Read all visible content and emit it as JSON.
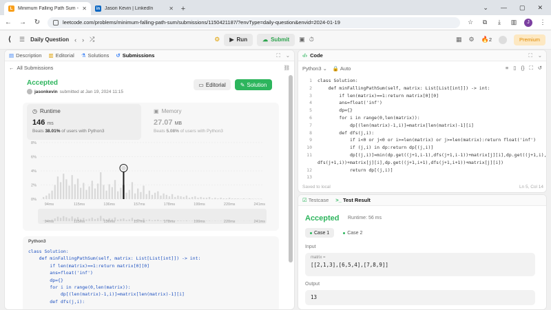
{
  "browser": {
    "tabs": [
      {
        "title": "Minimum Falling Path Sum - Le",
        "favicon": "leetcode-icon",
        "color": "#f89f1b"
      },
      {
        "title": "Jason Kevin | LinkedIn",
        "favicon": "linkedin-icon",
        "color": "#0a66c2"
      }
    ],
    "url": "leetcode.com/problems/minimum-falling-path-sum/submissions/1150421187/?envType=daily-question&envid=2024-01-19",
    "avatar_letter": "J"
  },
  "lcnav": {
    "daily": "Daily Question",
    "run": "Run",
    "submit": "Submit",
    "streak": "2",
    "premium": "Premium"
  },
  "left": {
    "tabs": [
      "Description",
      "Editorial",
      "Solutions",
      "Submissions"
    ],
    "back_link": "All Submissions",
    "status": "Accepted",
    "user": "jasonkevin",
    "submitted": "submitted at Jan 19, 2024 11:15",
    "editorial_btn": "Editorial",
    "solution_btn": "Solution",
    "runtime": {
      "label": "Runtime",
      "value": "146",
      "unit": "ms",
      "beats_prefix": "Beats",
      "beats": "38.01%",
      "beats_suffix": "of users with Python3"
    },
    "memory": {
      "label": "Memory",
      "value": "27.07",
      "unit": "MB",
      "beats_prefix": "Beats",
      "beats": "5.08%",
      "beats_suffix": "of users with Python3"
    },
    "code_lang": "Python3",
    "code_lines": [
      "class Solution:",
      "    def minFallingPathSum(self, matrix: List[List[int]]) -> int:",
      "        if len(matrix)==1:return matrix[0][0]",
      "        ans=float('inf')",
      "        dp={}",
      "        for i in range(0,len(matrix)):",
      "            dp[(len(matrix)-1,i)]=matrix[len(matrix)-1][i]",
      "        def dfs(j,i):"
    ]
  },
  "chart_data": {
    "type": "bar",
    "title": "",
    "xlabel": "",
    "ylabel": "",
    "yticks": [
      "8%",
      "6%",
      "4%",
      "2%",
      "0%"
    ],
    "ylim": [
      0,
      8
    ],
    "xticks": [
      "94ms",
      "115ms",
      "136ms",
      "157ms",
      "178ms",
      "199ms",
      "220ms",
      "241ms"
    ],
    "x": [
      90,
      92,
      94,
      96,
      98,
      100,
      102,
      104,
      106,
      108,
      110,
      112,
      114,
      116,
      118,
      120,
      122,
      124,
      126,
      128,
      130,
      132,
      134,
      136,
      138,
      140,
      142,
      144,
      146,
      148,
      150,
      152,
      154,
      156,
      158,
      160,
      162,
      164,
      166,
      168,
      170,
      172,
      174,
      176,
      178,
      180,
      182,
      184,
      186,
      188,
      190,
      192,
      194,
      196,
      198,
      200,
      202,
      204,
      206,
      208,
      210,
      212,
      214,
      216,
      218,
      220,
      222,
      224,
      226,
      228,
      230,
      232,
      234,
      236,
      238,
      240,
      242
    ],
    "values": [
      0.3,
      0.5,
      0.8,
      1.2,
      2.0,
      3.2,
      2.4,
      3.6,
      2.8,
      1.9,
      3.4,
      2.1,
      2.9,
      1.6,
      2.3,
      1.3,
      1.8,
      2.6,
      1.5,
      2.2,
      3.8,
      2.0,
      1.2,
      2.1,
      1.7,
      2.7,
      1.1,
      1.6,
      2.0,
      0.9,
      1.3,
      2.4,
      0.8,
      1.5,
      1.0,
      1.9,
      0.7,
      1.2,
      0.6,
      0.9,
      1.1,
      0.5,
      0.8,
      0.6,
      0.4,
      0.7,
      0.3,
      0.5,
      0.4,
      0.3,
      0.5,
      0.2,
      0.3,
      0.4,
      0.2,
      0.3,
      0.2,
      0.2,
      0.3,
      0.1,
      0.2,
      0.1,
      0.2,
      0.1,
      0.1,
      0.2,
      0.1,
      0.1,
      0.1,
      0.05,
      0.1,
      0.05,
      0.1,
      0.05,
      0.05,
      0.05,
      0.05
    ],
    "highlight_x": 146,
    "bar_color": "#d9d9d9",
    "highlight_color": "#1a1a1a",
    "overview_xticks": [
      "94ms",
      "115ms",
      "136ms",
      "157ms",
      "178ms",
      "199ms",
      "220ms",
      "241ms"
    ]
  },
  "right": {
    "title": "Code",
    "lang": "Python3",
    "mode": "Auto",
    "saved": "Saved to local",
    "cursor": "Ln 5, Col 14",
    "lines": [
      {
        "n": "1",
        "t": "class Solution:"
      },
      {
        "n": "2",
        "t": "    def minFallingPathSum(self, matrix: List[List[int]]) -> int:"
      },
      {
        "n": "3",
        "t": "        if len(matrix)==1:return matrix[0][0]"
      },
      {
        "n": "4",
        "t": "        ans=float('inf')"
      },
      {
        "n": "5",
        "t": "        dp={}"
      },
      {
        "n": "6",
        "t": "        for i in range(0,len(matrix)):"
      },
      {
        "n": "7",
        "t": "            dp[(len(matrix)-1,i)]=matrix[len(matrix)-1][i]"
      },
      {
        "n": "8",
        "t": "        def dfs(j,i):"
      },
      {
        "n": "9",
        "t": "            if i<0 or j<0 or i>=len(matrix) or j>=len(matrix):return float('inf')"
      },
      {
        "n": "10",
        "t": "            if (j,i) in dp:return dp[(j,i)]"
      },
      {
        "n": "11",
        "t": "            dp[(j,i)]=min(dp.get((j+1,i-1),dfs(j+1,i-1))+matrix[j][i],dp.get((j+1,i),"
      },
      {
        "n": "",
        "t": "dfs(j+1,i))+matrix[j][i],dp.get((j+1,i+1),dfs(j+1,i+1))+matrix[j][i])"
      },
      {
        "n": "12",
        "t": "            return dp[(j,i)]"
      },
      {
        "n": "13",
        "t": ""
      },
      {
        "n": "14",
        "t": "        for i in range(0,len(matrix[0])):"
      }
    ]
  },
  "test": {
    "tab_testcase": "Testcase",
    "tab_result": "Test Result",
    "status": "Accepted",
    "runtime": "Runtime: 56 ms",
    "cases": [
      "Case 1",
      "Case 2"
    ],
    "input_label": "Input",
    "var_name": "matrix =",
    "input_value": "[[2,1,3],[6,5,4],[7,8,9]]",
    "output_label": "Output",
    "output_value": "13"
  }
}
